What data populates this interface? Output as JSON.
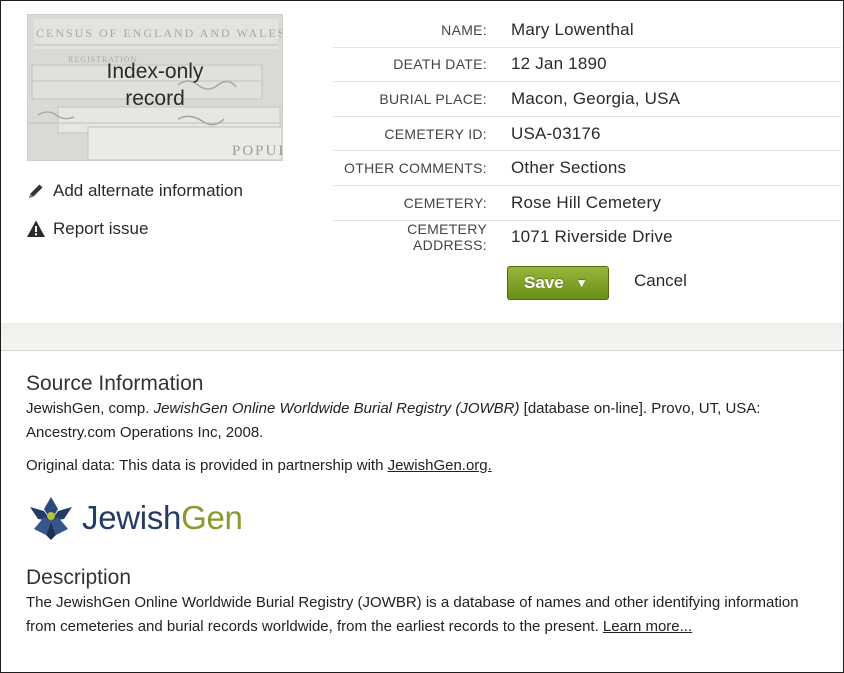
{
  "record_card": {
    "thumbnail": {
      "label_line1": "Index-only",
      "label_line2": "record",
      "bg_text_top": "CENSUS OF ENGLAND AND WALES",
      "bg_text_mid": "REGISTRATION",
      "bg_text_bottom": "POPUL"
    },
    "actions": {
      "add_alternate": "Add alternate information",
      "report_issue": "Report issue"
    },
    "fields": [
      {
        "label": "NAME:",
        "value": "Mary Lowenthal"
      },
      {
        "label": "DEATH DATE:",
        "value": "12 Jan 1890"
      },
      {
        "label": "BURIAL PLACE:",
        "value": "Macon, Georgia, USA"
      },
      {
        "label": "CEMETERY ID:",
        "value": "USA-03176"
      },
      {
        "label": "OTHER COMMENTS:",
        "value": "Other Sections"
      },
      {
        "label": "CEMETERY:",
        "value": "Rose Hill Cemetery"
      },
      {
        "label": "CEMETERY ADDRESS:",
        "value": "1071 Riverside Drive"
      }
    ],
    "save_label": "Save",
    "cancel_label": "Cancel"
  },
  "source": {
    "heading": "Source Information",
    "citation_prefix": "JewishGen, comp. ",
    "citation_title": "JewishGen Online Worldwide Burial Registry (JOWBR)",
    "citation_suffix": " [database on-line]. Provo, UT, USA: Ancestry.com Operations Inc, 2008.",
    "original_prefix": "Original data: This data is provided in partnership with ",
    "original_link": "JewishGen.org."
  },
  "logo": {
    "part1": "Jewish",
    "part2": "Gen"
  },
  "description": {
    "heading": "Description",
    "text": "The JewishGen Online Worldwide Burial Registry (JOWBR) is a database of names and other identifying information from cemeteries and burial records worldwide, from the earliest records to the present. ",
    "learn_more": "Learn more..."
  },
  "colors": {
    "save_button": "#7f9f25",
    "logo_blue": "#243b66",
    "logo_green": "#8a9a2c"
  }
}
